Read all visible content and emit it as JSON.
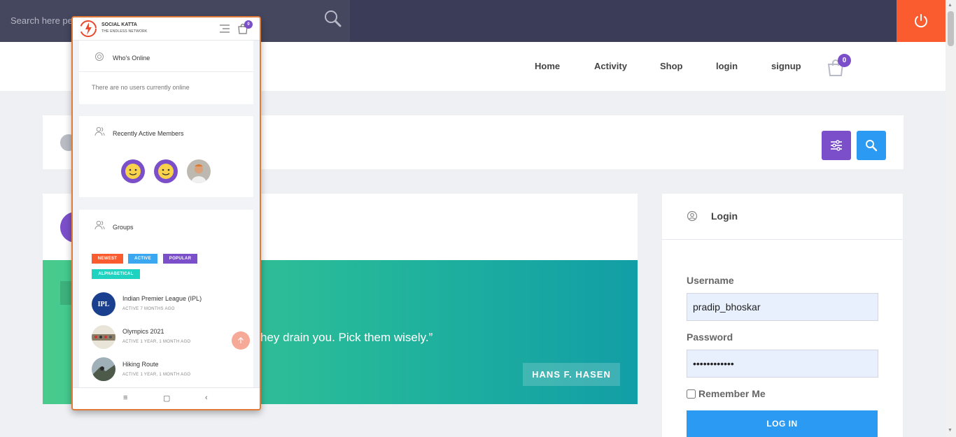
{
  "search": {
    "placeholder": "Search here people, groups"
  },
  "nav": {
    "items": [
      "Home",
      "Activity",
      "Shop",
      "login",
      "signup"
    ],
    "cart_count": "0"
  },
  "quote": {
    "text": "hey drain you. Pick them wisely.”",
    "author": "HANS F. HASEN"
  },
  "login": {
    "title": "Login",
    "username_label": "Username",
    "username_value": "pradip_bhoskar",
    "password_label": "Password",
    "password_value": "••••••••••••",
    "remember_label": "Remember Me",
    "button_label": "LOG IN"
  },
  "phone": {
    "brand_line1": "SOCIAL KATTA",
    "brand_line2": "THE ENDLESS NETWORK",
    "cart_count": "0",
    "whos_online_title": "Who's Online",
    "whos_online_empty": "There are no users currently online",
    "recent_members_title": "Recently Active Members",
    "groups_title": "Groups",
    "tags": [
      "NEWEST",
      "ACTIVE",
      "POPULAR",
      "ALPHABETICAL"
    ],
    "groups": [
      {
        "name": "Indian Premier League (IPL)",
        "meta": "ACTIVE 7 MONTHS AGO",
        "thumb_text": "IPL"
      },
      {
        "name": "Olympics 2021",
        "meta": "ACTIVE 1 YEAR, 1 MONTH AGO"
      },
      {
        "name": "Hiking Route",
        "meta": "ACTIVE 1 YEAR, 1 MONTH AGO"
      }
    ]
  },
  "colors": {
    "topbar": "#3b3d58",
    "power": "#fa5c30",
    "accent_purple": "#7b4fc9",
    "accent_blue": "#2b9af3",
    "tag_newest": "#fa5c30",
    "tag_active": "#3aa7f0",
    "tag_popular": "#7b4fc9",
    "tag_alphabetical": "#1fd3c0"
  }
}
